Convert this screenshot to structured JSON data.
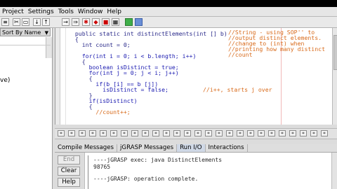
{
  "menu": [
    "Project",
    "Settings",
    "Tools",
    "Window",
    "Help"
  ],
  "toolbar": {
    "icons": [
      "sort-icon",
      "cut-icon",
      "paste-icon",
      "down-arrow-icon",
      "up-arrow-icon",
      "run-icon",
      "debug-bug-icon",
      "step-icon",
      "stop-icon",
      "clear-icon",
      "generate-csd-icon",
      "remove-csd-icon"
    ]
  },
  "left_panel": {
    "sort_label": "Sort By Name",
    "row_text": "ve)"
  },
  "editor": {
    "lines": [
      "  public static int distinctElements(int [] b)",
      "  {",
      "    int count = 0;",
      "",
      "    for(int i = 0; i < b.length; i++)",
      "    {",
      "      boolean isDistinct = true;",
      "      for(int j = 0; j < i; j++)",
      "      {",
      "        if(b [i] == b [j])",
      "          isDistinct = false;",
      "      }",
      "      if(isDistinct)",
      "      {",
      "        //count++;"
    ],
    "inline_comment": "//i++, starts j over",
    "side_comments": [
      "//String - using SOP'' to",
      "//output distinct elements.",
      "//change to (int) when",
      "//printing how many distinct",
      "//count"
    ]
  },
  "tabs": [
    "Compile Messages",
    "jGRASP Messages",
    "Run I/O",
    "Interactions"
  ],
  "buttons": {
    "end": "End",
    "clear": "Clear",
    "help": "Help"
  },
  "output": {
    "line1": "----jGRASP exec: java DistinctElements",
    "line2": "98765",
    "line3": "----jGRASP: operation complete."
  }
}
